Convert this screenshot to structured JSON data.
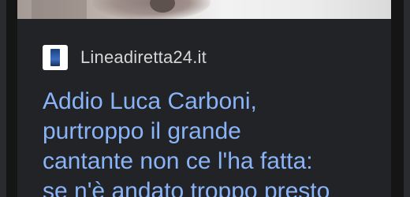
{
  "card": {
    "source": {
      "logo_icon": "lineadiretta24-logo-icon",
      "name": "Lineadiretta24.it"
    },
    "headline_lines": [
      "Addio Luca Carboni,",
      "purtroppo il grande",
      "cantante non ce l'ha fatta:",
      "se n'è andato troppo presto"
    ]
  },
  "colors": {
    "headline": "#8ab4f8",
    "card_background": "#222326",
    "source_text": "#d6d6d6"
  }
}
